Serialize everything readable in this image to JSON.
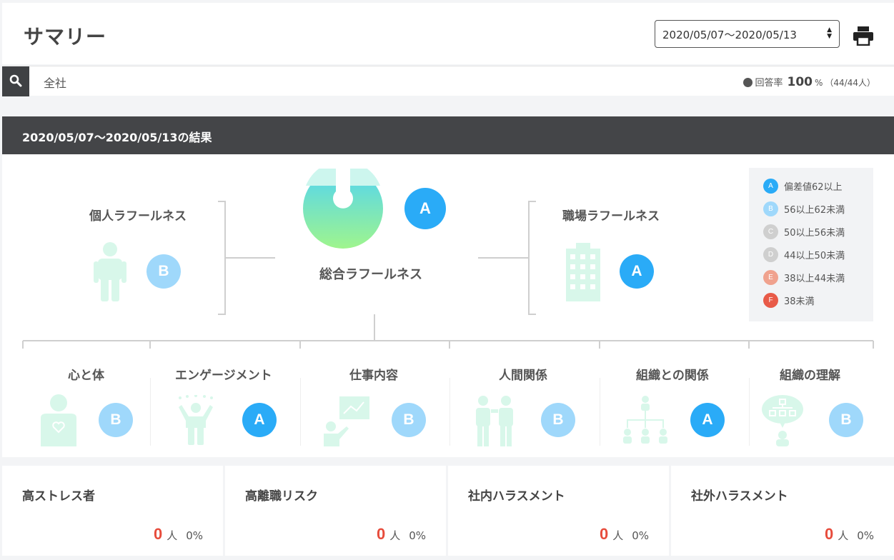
{
  "header": {
    "title": "サマリー",
    "date_range": "2020/05/07〜2020/05/13",
    "print_icon": "print-icon"
  },
  "search": {
    "icon": "search-icon",
    "value": "全社",
    "response_label": "回答率",
    "response_rate": "100",
    "response_unit": "%",
    "response_count": "（44/44人）"
  },
  "result": {
    "title": "2020/05/07〜2020/05/13の結果",
    "overall": {
      "label": "総合ラフールネス",
      "grade": "A"
    },
    "personal": {
      "label": "個人ラフールネス",
      "grade": "B",
      "icon": "person-icon"
    },
    "workplace": {
      "label": "職場ラフールネス",
      "grade": "A",
      "icon": "building-icon"
    },
    "categories": [
      {
        "label": "心と体",
        "grade": "B",
        "icon": "heart-body-icon"
      },
      {
        "label": "エンゲージメント",
        "grade": "A",
        "icon": "cheering-person-icon"
      },
      {
        "label": "仕事内容",
        "grade": "B",
        "icon": "presentation-icon"
      },
      {
        "label": "人間関係",
        "grade": "B",
        "icon": "two-people-icon"
      },
      {
        "label": "組織との関係",
        "grade": "A",
        "icon": "org-chart-icon"
      },
      {
        "label": "組織の理解",
        "grade": "B",
        "icon": "speech-org-icon"
      }
    ],
    "legend": [
      {
        "grade": "A",
        "text": "偏差値62以上",
        "color": "#2aabf7"
      },
      {
        "grade": "B",
        "text": "56以上62未満",
        "color": "#9fd8fb"
      },
      {
        "grade": "C",
        "text": "50以上56未満",
        "color": "#cfcfcf"
      },
      {
        "grade": "D",
        "text": "44以上50未満",
        "color": "#cfcfcf"
      },
      {
        "grade": "E",
        "text": "38以上44未満",
        "color": "#f0a28e"
      },
      {
        "grade": "F",
        "text": "38未満",
        "color": "#e85a48"
      }
    ]
  },
  "risks": [
    {
      "title": "高ストレス者",
      "count": "0",
      "unit": "人",
      "percent": "0%"
    },
    {
      "title": "高離職リスク",
      "count": "0",
      "unit": "人",
      "percent": "0%"
    },
    {
      "title": "社内ハラスメント",
      "count": "0",
      "unit": "人",
      "percent": "0%"
    },
    {
      "title": "社外ハラスメント",
      "count": "0",
      "unit": "人",
      "percent": "0%"
    }
  ]
}
